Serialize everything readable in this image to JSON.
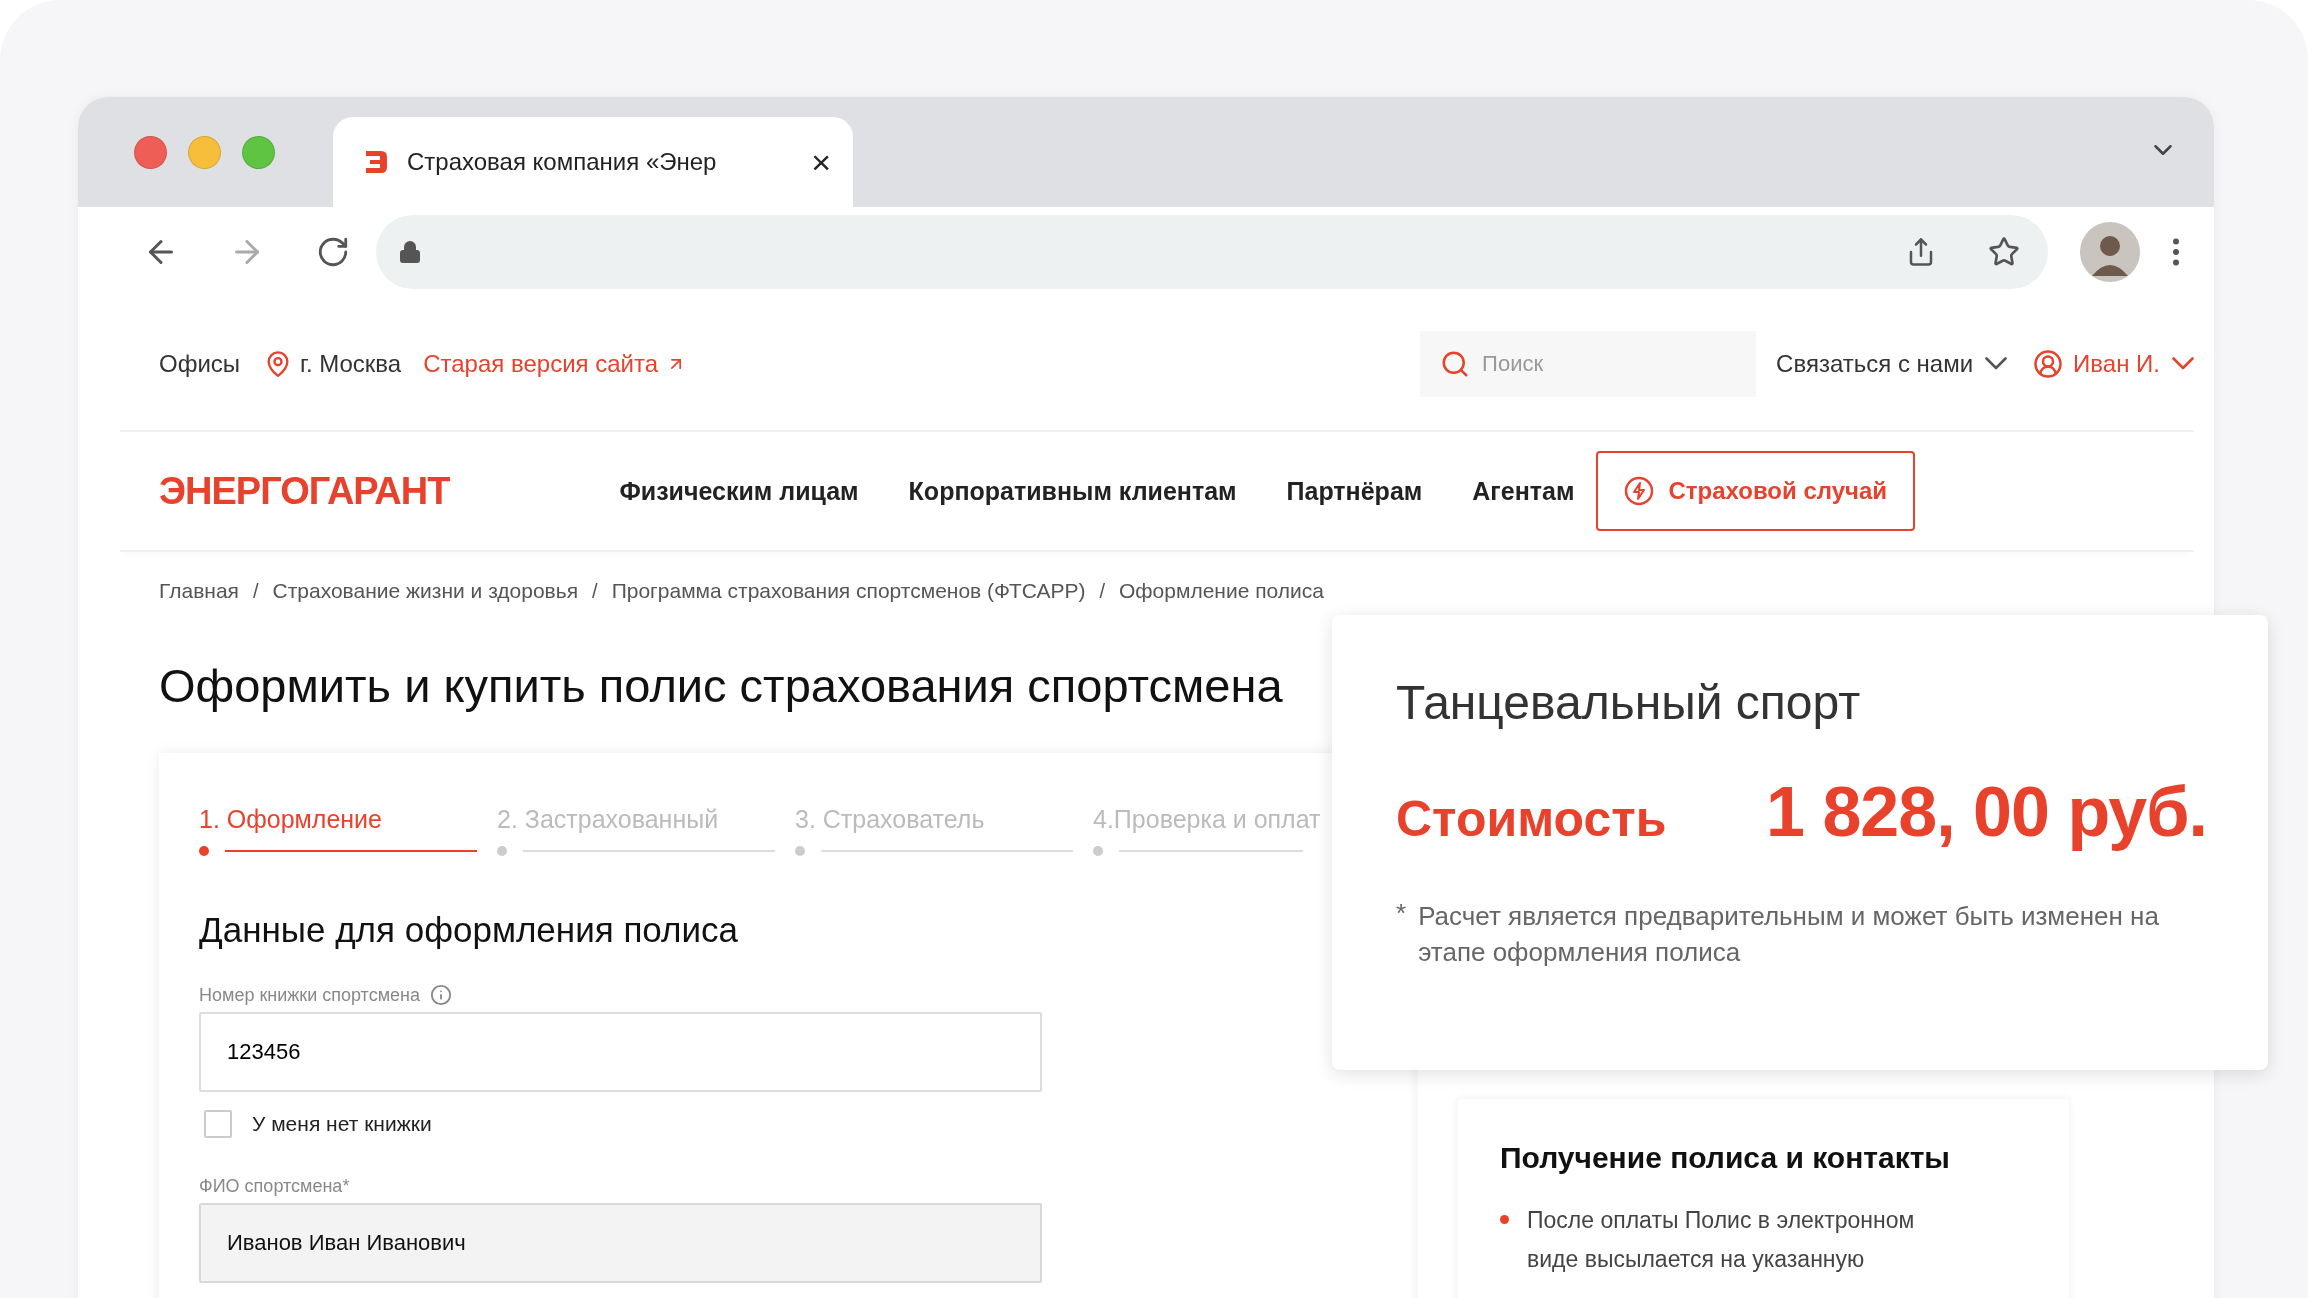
{
  "browser": {
    "tab": {
      "title": "Страховая компания «Энер",
      "selected": true
    },
    "tab_close": "×"
  },
  "top_bar": {
    "offices": "Офисы",
    "city": "г. Москва",
    "old_site_link": "Старая версия сайта",
    "search": {
      "placeholder": "Поиск"
    },
    "contact": "Связаться с нами",
    "user": "Иван И."
  },
  "nav": {
    "logo": "ЭНЕРГОГАРАНТ",
    "items": [
      "Физическим лицам",
      "Корпоративным клиентам",
      "Партнёрам",
      "Агентам"
    ],
    "claim_button": "Страховой случай"
  },
  "breadcrumb_separator": "/",
  "breadcrumbs": [
    "Главная",
    "Страхование жизни и здоровья",
    "Программа страхования спортсменов (ФТСАРР)",
    "Оформление полиса"
  ],
  "title": "Оформить и купить полис страхования спортсмена",
  "form": {
    "steps": [
      {
        "label": "1. Оформление",
        "selected": true
      },
      {
        "label": "2. Застрахованный",
        "selected": false
      },
      {
        "label": "3. Страхователь",
        "selected": false
      },
      {
        "label": "4.Проверка и оплат",
        "selected": false
      }
    ],
    "section_title": "Данные для оформления полиса",
    "fields": [
      {
        "label": "Номер книжки спортсмена",
        "info": true,
        "value": "123456",
        "disabled": false
      },
      {
        "kind": "checkbox",
        "label": "У меня нет книжки",
        "checked": false
      },
      {
        "label": "ФИО спортсмена*",
        "info": false,
        "value": "Иванов Иван Иванович",
        "disabled": true
      }
    ]
  },
  "price_card": {
    "sport": "Танцевальный спорт",
    "cost_label": "Стоимость",
    "price": "1 828, 00 руб.",
    "note_mark": "*",
    "note": "Расчет является предварительным и может быть изменен на этапе оформления полиса"
  },
  "info_card": {
    "title": "Получение полиса и контакты",
    "bullets": [
      "После оплаты Полис в электронном виде высылается на указанную"
    ]
  }
}
